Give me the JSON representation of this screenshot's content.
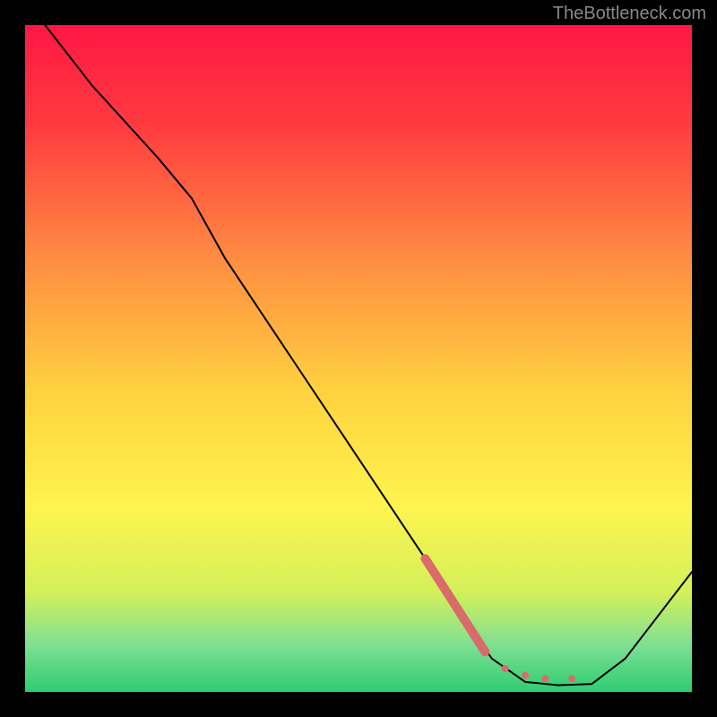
{
  "watermark": "TheBottleneck.com",
  "chart_data": {
    "type": "line",
    "title": "",
    "xlabel": "",
    "ylabel": "",
    "xlim": [
      0,
      100
    ],
    "ylim": [
      0,
      100
    ],
    "background_gradient": {
      "stops": [
        {
          "offset": 0.0,
          "color": "#ff1744"
        },
        {
          "offset": 0.15,
          "color": "#ff3b3f"
        },
        {
          "offset": 0.35,
          "color": "#ff8c42"
        },
        {
          "offset": 0.55,
          "color": "#ffd23f"
        },
        {
          "offset": 0.72,
          "color": "#fff44f"
        },
        {
          "offset": 0.85,
          "color": "#d4f05a"
        },
        {
          "offset": 0.93,
          "color": "#7ee093"
        },
        {
          "offset": 1.0,
          "color": "#2ecc71"
        }
      ]
    },
    "series": [
      {
        "name": "curve",
        "color": "#000000",
        "stroke_width": 2,
        "points": [
          {
            "x": 3,
            "y": 100
          },
          {
            "x": 10,
            "y": 91
          },
          {
            "x": 20,
            "y": 80
          },
          {
            "x": 25,
            "y": 74
          },
          {
            "x": 30,
            "y": 65
          },
          {
            "x": 40,
            "y": 50
          },
          {
            "x": 50,
            "y": 35
          },
          {
            "x": 60,
            "y": 20
          },
          {
            "x": 65,
            "y": 12
          },
          {
            "x": 70,
            "y": 5
          },
          {
            "x": 75,
            "y": 1.5
          },
          {
            "x": 80,
            "y": 1
          },
          {
            "x": 85,
            "y": 1.2
          },
          {
            "x": 90,
            "y": 5
          },
          {
            "x": 100,
            "y": 18
          }
        ]
      },
      {
        "name": "highlight-segment",
        "color": "#d96b6b",
        "stroke_width": 10,
        "points": [
          {
            "x": 60,
            "y": 20
          },
          {
            "x": 69,
            "y": 6
          }
        ]
      }
    ],
    "dots": [
      {
        "x": 72,
        "y": 3.5,
        "r": 4,
        "color": "#d96b6b"
      },
      {
        "x": 75,
        "y": 2.5,
        "r": 4,
        "color": "#d96b6b"
      },
      {
        "x": 78,
        "y": 2,
        "r": 4,
        "color": "#d96b6b"
      },
      {
        "x": 82,
        "y": 2,
        "r": 4,
        "color": "#d96b6b"
      }
    ]
  }
}
